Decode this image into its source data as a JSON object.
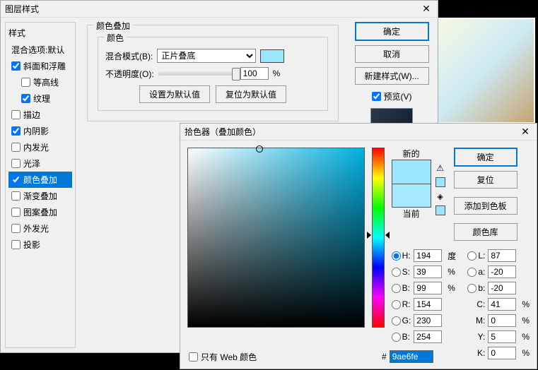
{
  "ls": {
    "title": "图层样式",
    "styles_header": "样式",
    "blend_options": "混合选项:默认",
    "items": [
      {
        "label": "斜面和浮雕",
        "cb": true,
        "checked": true
      },
      {
        "label": "等高线",
        "cb": true,
        "checked": false,
        "indent": true
      },
      {
        "label": "纹理",
        "cb": true,
        "checked": true,
        "indent": true
      },
      {
        "label": "描边",
        "cb": true,
        "checked": false
      },
      {
        "label": "内阴影",
        "cb": true,
        "checked": true
      },
      {
        "label": "内发光",
        "cb": true,
        "checked": false
      },
      {
        "label": "光泽",
        "cb": true,
        "checked": false
      },
      {
        "label": "颜色叠加",
        "cb": true,
        "checked": true,
        "sel": true
      },
      {
        "label": "渐变叠加",
        "cb": true,
        "checked": false
      },
      {
        "label": "图案叠加",
        "cb": true,
        "checked": false
      },
      {
        "label": "外发光",
        "cb": true,
        "checked": false
      },
      {
        "label": "投影",
        "cb": true,
        "checked": false
      }
    ],
    "section_title": "颜色叠加",
    "color_group": "颜色",
    "blend_mode_label": "混合模式(B):",
    "blend_mode_value": "正片叠底",
    "opacity_label": "不透明度(O):",
    "opacity_value": "100",
    "pct": "%",
    "set_default": "设置为默认值",
    "reset_default": "复位为默认值",
    "ok": "确定",
    "cancel": "取消",
    "new_style": "新建样式(W)...",
    "preview": "预览(V)"
  },
  "cp": {
    "title": "拾色器（叠加颜色）",
    "new_label": "新的",
    "current_label": "当前",
    "ok": "确定",
    "reset": "复位",
    "add_swatch": "添加到色板",
    "libraries": "颜色库",
    "web_only": "只有 Web 颜色",
    "hex": "9ae6fe",
    "deg": "度",
    "pct": "%",
    "H": {
      "l": "H:",
      "v": "194"
    },
    "S": {
      "l": "S:",
      "v": "39"
    },
    "Bv": {
      "l": "B:",
      "v": "99"
    },
    "R": {
      "l": "R:",
      "v": "154"
    },
    "G": {
      "l": "G:",
      "v": "230"
    },
    "Bb": {
      "l": "B:",
      "v": "254"
    },
    "L": {
      "l": "L:",
      "v": "87"
    },
    "a": {
      "l": "a:",
      "v": "-20"
    },
    "b": {
      "l": "b:",
      "v": "-20"
    },
    "C": {
      "l": "C:",
      "v": "41"
    },
    "M": {
      "l": "M:",
      "v": "0"
    },
    "Y": {
      "l": "Y:",
      "v": "5"
    },
    "K": {
      "l": "K:",
      "v": "0"
    }
  }
}
